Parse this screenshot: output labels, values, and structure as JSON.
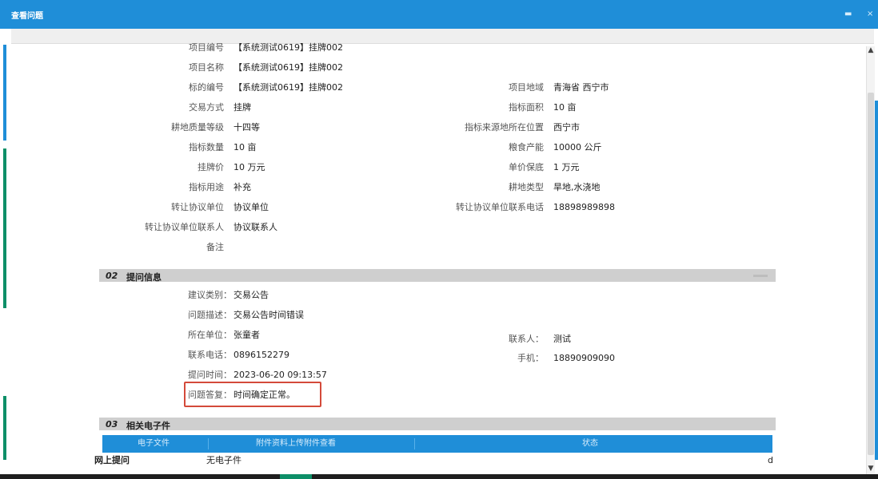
{
  "window": {
    "title": "查看问题",
    "close_icon": "close-icon",
    "minimize_icon": "dash-icon"
  },
  "project": {
    "fields": [
      {
        "label": "项目编号",
        "value": "【系统测试0619】挂牌002"
      },
      {
        "label": "项目名称",
        "value": "【系统测试0619】挂牌002"
      },
      {
        "label": "标的编号",
        "value": "【系统测试0619】挂牌002"
      },
      {
        "label": "交易方式",
        "value": "挂牌"
      },
      {
        "label": "耕地质量等级",
        "value": "十四等"
      },
      {
        "label": "指标数量",
        "value": "10 亩"
      },
      {
        "label": "挂牌价",
        "value": "10 万元"
      },
      {
        "label": "指标用途",
        "value": "补充"
      },
      {
        "label": "转让协议单位",
        "value": "协议单位"
      },
      {
        "label": "转让协议单位联系人",
        "value": "协议联系人"
      },
      {
        "label": "备注",
        "value": ""
      }
    ],
    "right_fields": [
      {
        "label": "项目地域",
        "value": "青海省 西宁市"
      },
      {
        "label": "指标面积",
        "value": "10 亩"
      },
      {
        "label": "指标来源地所在位置",
        "value": "西宁市"
      },
      {
        "label": "粮食产能",
        "value": "10000 公斤"
      },
      {
        "label": "单价保底",
        "value": "1 万元"
      },
      {
        "label": "耕地类型",
        "value": "旱地,水浇地"
      },
      {
        "label": "转让协议单位联系电话",
        "value": "18898989898"
      }
    ]
  },
  "question_section": {
    "number": "02",
    "title": "提问信息",
    "fields": [
      {
        "label": "建议类别：",
        "value": "交易公告"
      },
      {
        "label": "问题描述：",
        "value": "交易公告时间错误"
      },
      {
        "label": "所在单位：",
        "value": "张童者"
      },
      {
        "label": "联系电话：",
        "value": "0896152279"
      },
      {
        "label": "提问时间：",
        "value": "2023-06-20 09:13:57"
      },
      {
        "label": "问题答复：",
        "value": "时间确定正常。"
      }
    ],
    "right_fields": [
      {
        "label": "联系人：",
        "value": "测试"
      },
      {
        "label": "手机：",
        "value": "18890909090"
      }
    ]
  },
  "attachments_section": {
    "number": "03",
    "title": "相关电子件",
    "tabs": [
      "电子文件",
      "附件资料上传附件查看",
      "状态"
    ],
    "row": {
      "col1": "网上提问",
      "col2": "无电子件",
      "col3": "d"
    }
  },
  "colors": {
    "brand_blue": "#1f8ed8",
    "accent_green": "#0d8f68",
    "highlight_red": "#d44a3a",
    "section_gray": "#cfcfcf"
  }
}
